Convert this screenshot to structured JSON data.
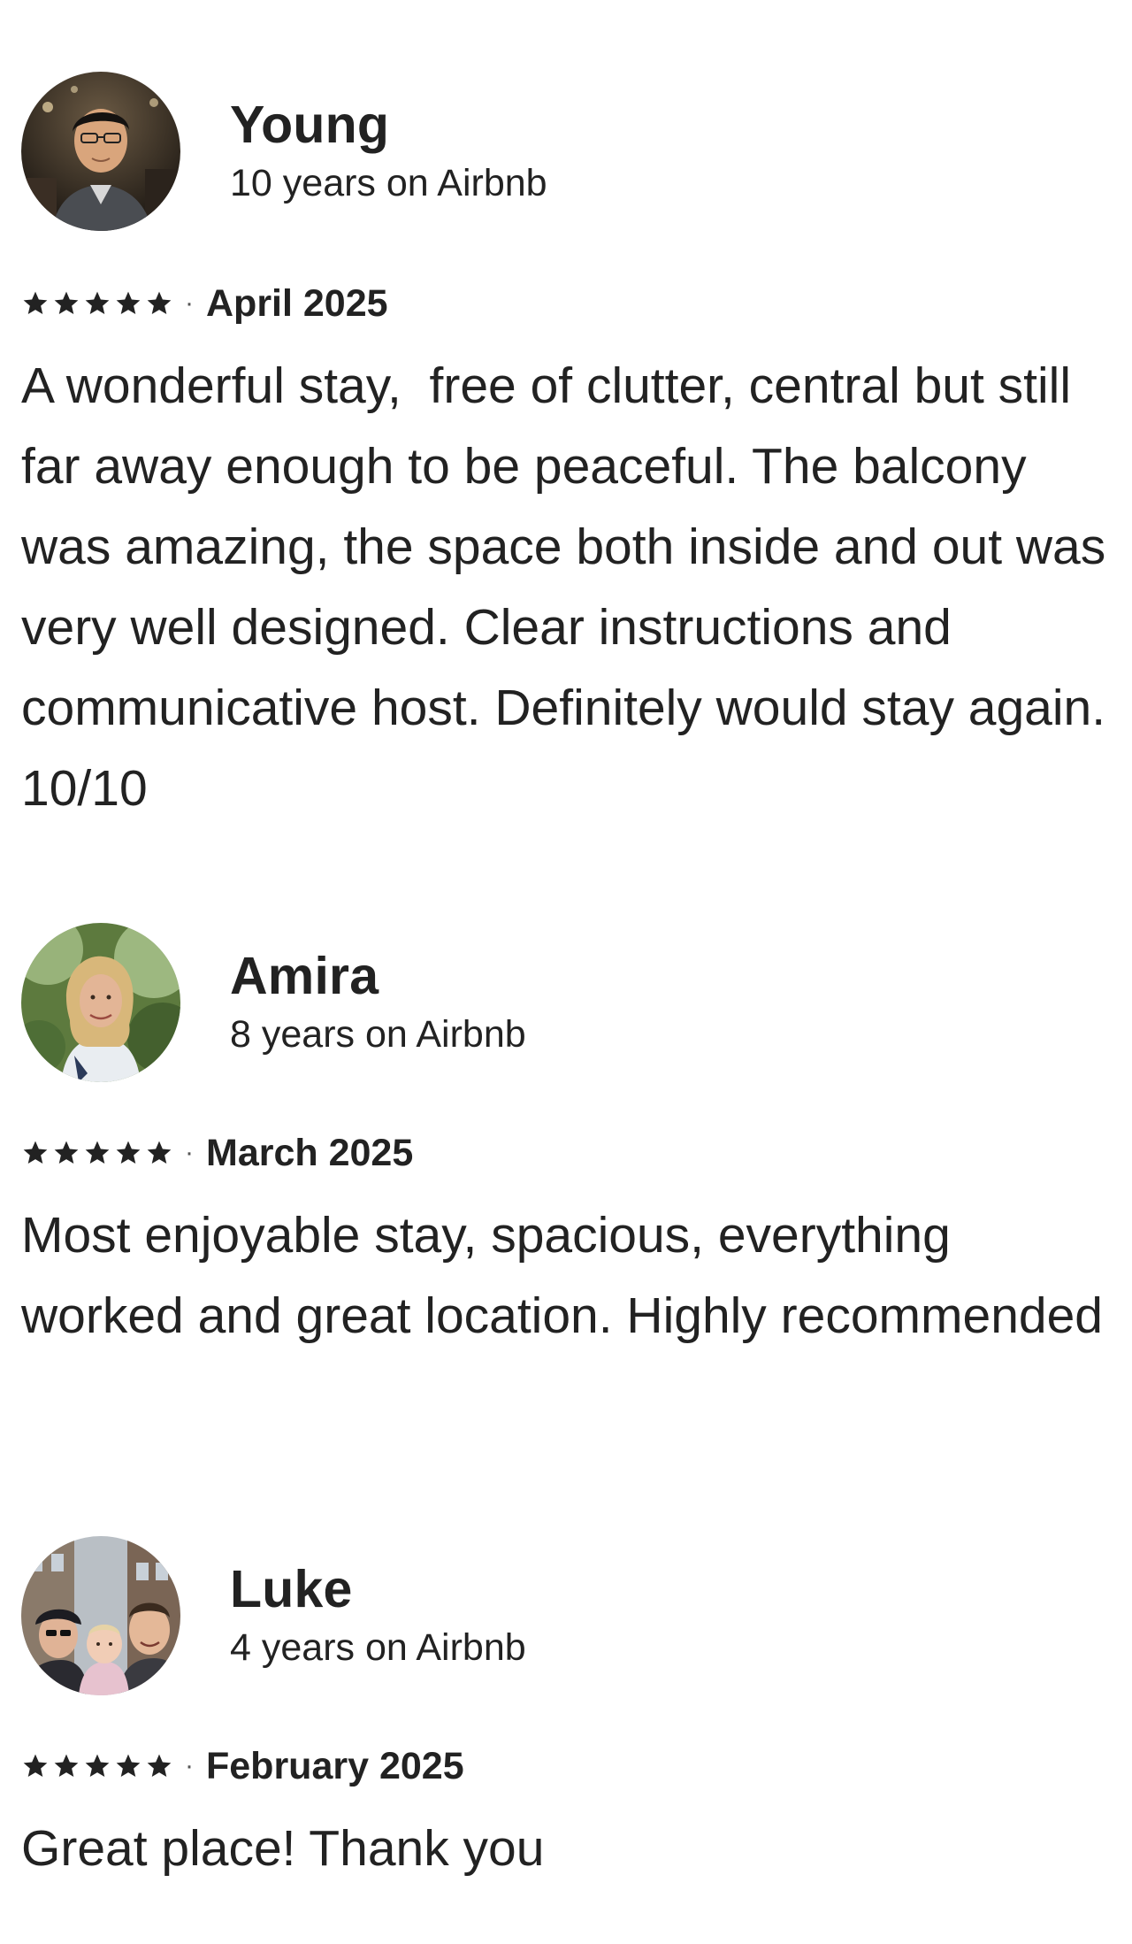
{
  "reviews": [
    {
      "name": "Young",
      "tenure": "10 years on Airbnb",
      "rating": 5,
      "separator": "·",
      "date": "April 2025",
      "text": "A wonderful stay,  free of clutter, central but still far away enough to be peaceful. The balcony was amazing, the space both inside and out was very well designed. Clear instructions and communicative host. Definitely would stay again. 10/10"
    },
    {
      "name": "Amira",
      "tenure": "8 years on Airbnb",
      "rating": 5,
      "separator": "·",
      "date": "March 2025",
      "text": "Most enjoyable stay, spacious, everything worked and great location. Highly recommended"
    },
    {
      "name": "Luke",
      "tenure": "4 years on Airbnb",
      "rating": 5,
      "separator": "·",
      "date": "February 2025",
      "text": "Great place! Thank you"
    }
  ],
  "colors": {
    "text": "#222222",
    "star": "#222222",
    "background": "#ffffff"
  },
  "icons": {
    "rating": "star-icon"
  }
}
